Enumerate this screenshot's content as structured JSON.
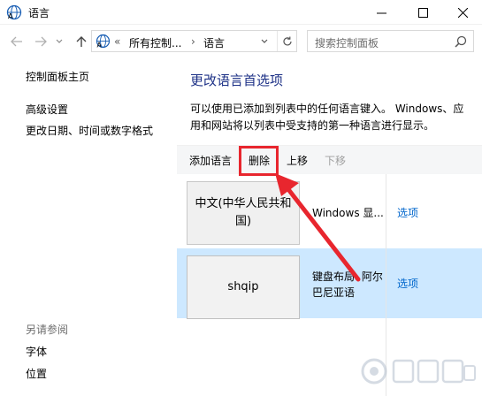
{
  "window": {
    "title": "语言",
    "icon": "language-icon",
    "minimize_icon": "minimize-icon",
    "maximize_icon": "maximize-icon",
    "close_icon": "close-icon"
  },
  "address_bar": {
    "overflow": "«",
    "segments": [
      "所有控制...",
      "语言"
    ],
    "separator": "›",
    "refresh_icon": "refresh-icon"
  },
  "search": {
    "placeholder": "搜索控制面板",
    "icon": "search-icon"
  },
  "left_nav": {
    "links": [
      "控制面板主页",
      "高级设置",
      "更改日期、时间或数字格式"
    ],
    "see_also_label": "另请参阅",
    "see_also_links": [
      "字体",
      "位置"
    ]
  },
  "main": {
    "title": "更改语言首选项",
    "description": "可以使用已添加到列表中的任何语言键入。 Windows、应用和网站将以列表中受支持的第一种语言进行显示。",
    "toolbar": {
      "add": "添加语言",
      "remove": "删除",
      "move_up": "上移",
      "move_down": "下移"
    },
    "languages": [
      {
        "name": "中文(中华人民共和国)",
        "info": "Windows 显...",
        "options": "选项",
        "selected": false
      },
      {
        "name": "shqip",
        "info": "键盘布局: 阿尔巴尼亚语",
        "options": "选项",
        "selected": true
      }
    ]
  },
  "annotation": {
    "highlight_color": "#e8262e",
    "arrow_color": "#e8262e"
  },
  "colors": {
    "title_blue": "#1e3287",
    "link_blue": "#0066cc",
    "selected_row": "#cde8ff"
  }
}
